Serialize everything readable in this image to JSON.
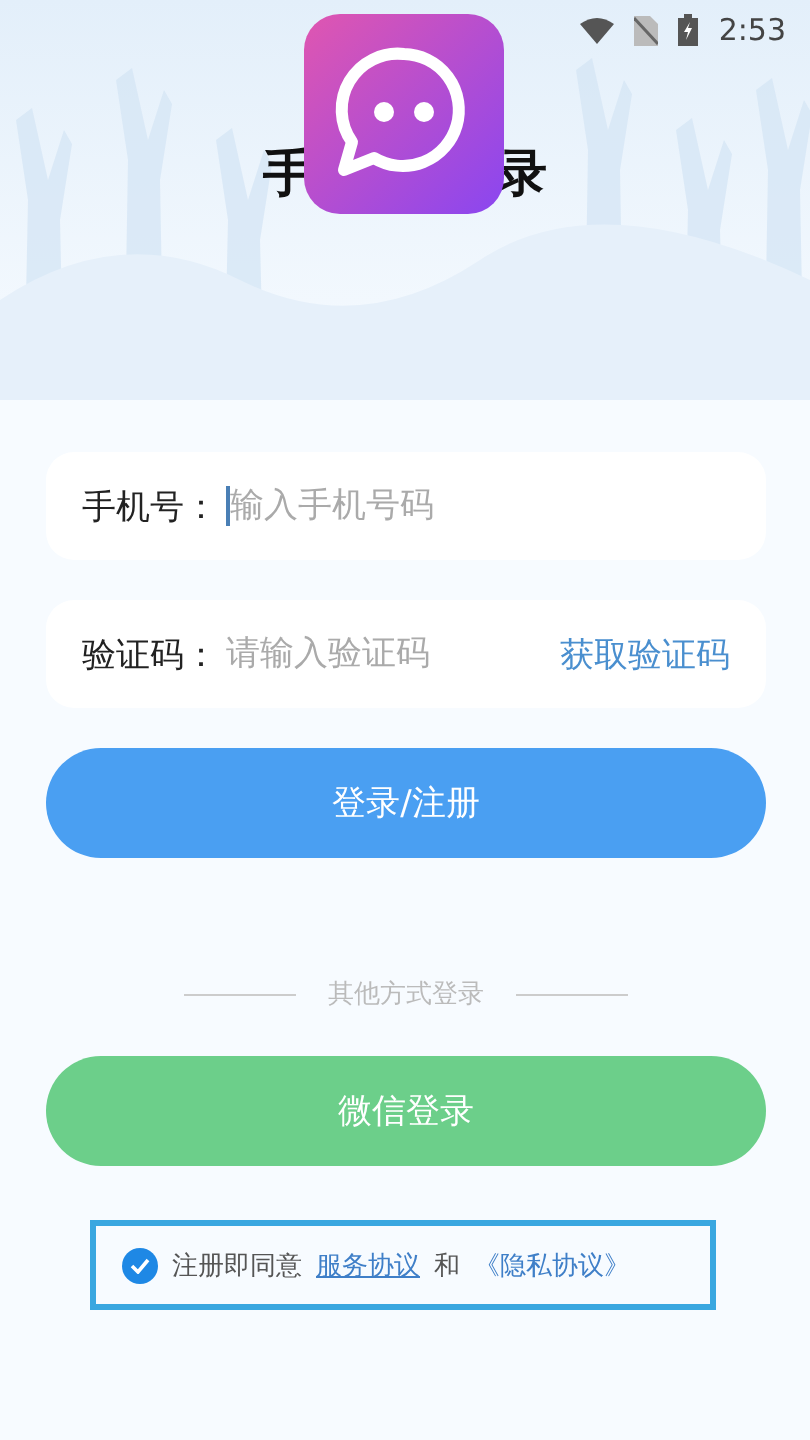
{
  "status_bar": {
    "time": "2:53"
  },
  "title_parts": [
    "手",
    "录"
  ],
  "fields": [
    {
      "label": "手机号：",
      "placeholder": "输入手机号码",
      "focused": true
    },
    {
      "label": "验证码：",
      "placeholder": "请输入验证码",
      "focused": false,
      "action": "获取验证码"
    }
  ],
  "login_button": "登录/注册",
  "divider": "其他方式登录",
  "wechat_button": "微信登录",
  "agreement": {
    "checked": true,
    "highlighted": true,
    "text": "注册即同意",
    "link1": "服务协议",
    "joiner": "和",
    "link2": "《隐私协议》"
  }
}
